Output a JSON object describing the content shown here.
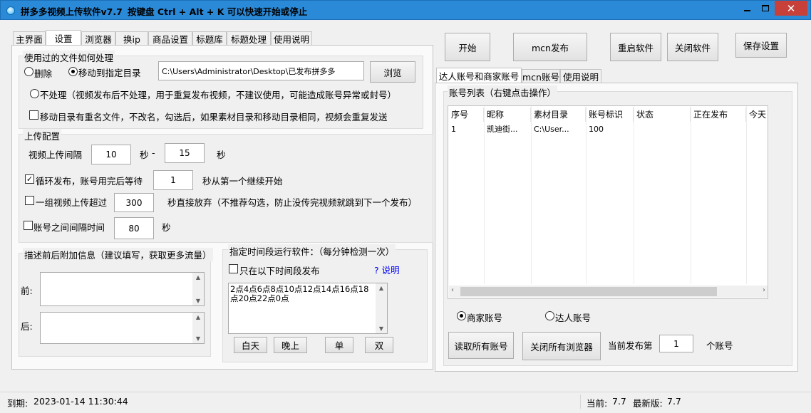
{
  "window": {
    "title": "拼多多视频上传软件v7.7",
    "hotkey_hint": "按键盘 Ctrl + Alt + K  可以快速开始或停止"
  },
  "colors": {
    "titlebar": "#2a8ad8",
    "close_button": "#c7403a",
    "link": "#0000ff"
  },
  "left_tabs": [
    "主界面",
    "设置",
    "浏览器",
    "换ip",
    "商品设置",
    "标题库",
    "标题处理",
    "使用说明"
  ],
  "left_active_tab": "设置",
  "file_handling": {
    "legend": "使用过的文件如何处理",
    "delete_label": "删除",
    "move_label": "移动到指定目录",
    "move_path": "C:\\Users\\Administrator\\Desktop\\已发布拼多多",
    "browse_button": "浏览",
    "nothing_label": "不处理（视频发布后不处理，用于重复发布视频，不建议使用，可能造成账号异常或封号）",
    "rename_label": "移动目录有重名文件，不改名，勾选后，如果素材目录和移动目录相同，视频会重复发送",
    "selected": "move"
  },
  "upload_config": {
    "legend": "上传配置",
    "interval_label": "视频上传间隔",
    "interval_min": "10",
    "sec_label": "秒",
    "dash": "-",
    "interval_max": "15",
    "sec_label2": "秒",
    "loop_label": "循环发布，账号用完后等待",
    "loop_checked": true,
    "loop_value": "1",
    "loop_suffix": "秒从第一个继续开始",
    "group_label": "一组视频上传超过",
    "group_value": "300",
    "group_suffix": "秒直接放弃（不推荐勾选，防止没传完视频就跳到下一个发布）",
    "acct_interval_label": "账号之间间隔时间",
    "acct_interval_value": "80",
    "acct_sec": "秒"
  },
  "desc_extra": {
    "legend": "描述前后附加信息（建议填写，获取更多流量）",
    "before_label": "前:",
    "after_label": "后:"
  },
  "schedule": {
    "legend": "指定时间段运行软件：（每分钟检测一次）",
    "only_label": "只在以下时间段发布",
    "help_link": "? 说明",
    "times": "2点4点6点8点10点12点14点16点18点20点22点0点",
    "btn_day": "白天",
    "btn_night": "晚上",
    "btn_odd": "单",
    "btn_even": "双"
  },
  "top_buttons": {
    "start": "开始",
    "mcn_publish": "mcn发布",
    "restart": "重启软件",
    "close_software": "关闭软件",
    "save_settings": "保存设置"
  },
  "right_tabs": [
    "达人账号和商家账号",
    "mcn账号",
    "使用说明"
  ],
  "account_list": {
    "legend": "账号列表（右键点击操作）",
    "columns": [
      "序号",
      "昵称",
      "素材目录",
      "账号标识",
      "状态",
      "正在发布",
      "今天"
    ],
    "rows": [
      {
        "index": "1",
        "nickname": "凯迪街...",
        "dir": "C:\\User...",
        "account_id": "100",
        "status": "",
        "publishing": "",
        "today": ""
      }
    ]
  },
  "account_type": {
    "merchant": "商家账号",
    "influencer": "达人账号",
    "selected": "merchant"
  },
  "bottom_right": {
    "read_all": "读取所有账号",
    "close_browsers": "关闭所有浏览器",
    "current_label": "当前发布第",
    "current_value": "1",
    "unit": "个账号"
  },
  "statusbar": {
    "expiry_label": "到期:",
    "expiry_value": "2023-01-14 11:30:44",
    "current_label": "当前:",
    "current_value": "7.7",
    "latest_label": "最新版:",
    "latest_value": "7.7"
  }
}
